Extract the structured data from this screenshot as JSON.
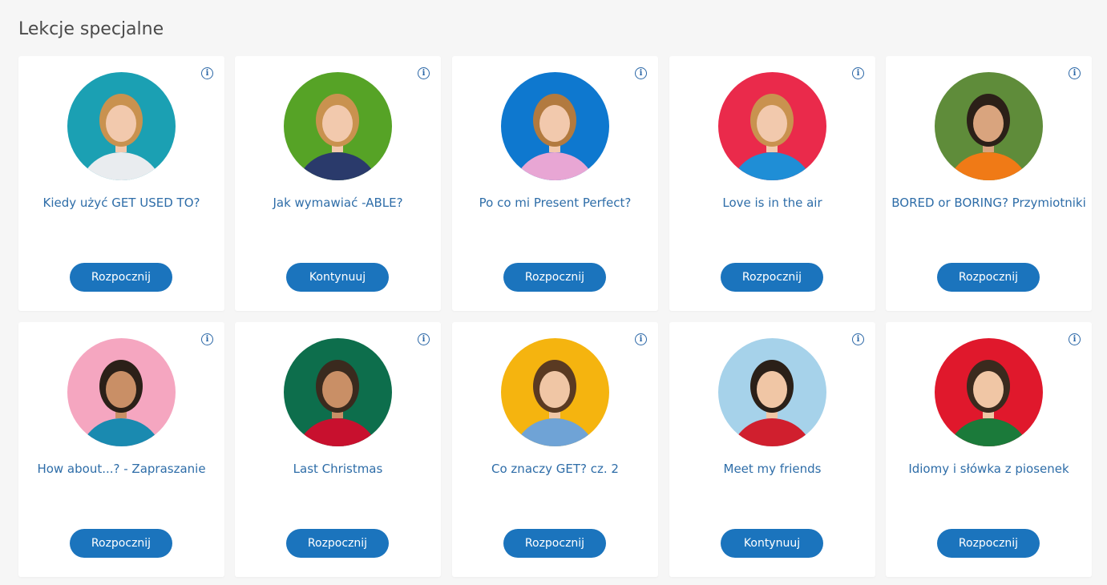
{
  "page": {
    "title": "Lekcje specjalne"
  },
  "info_icon_glyph": "i",
  "cards": [
    {
      "title": "Kiedy użyć GET USED TO?",
      "button": "Rozpocznij",
      "bg": "#1ba0b3",
      "shirt": "#e9ecef",
      "hair": "#c9924f",
      "skin": "#f2c9ad"
    },
    {
      "title": "Jak wymawiać -ABLE?",
      "button": "Kontynuuj",
      "bg": "#56a326",
      "shirt": "#2a3a6b",
      "hair": "#c9924f",
      "skin": "#f2c9ad"
    },
    {
      "title": "Po co mi Present Perfect?",
      "button": "Rozpocznij",
      "bg": "#0e78cf",
      "shirt": "#e8a6d4",
      "hair": "#b27a3f",
      "skin": "#f2c9ad"
    },
    {
      "title": "Love is in the air",
      "button": "Rozpocznij",
      "bg": "#ea2a4b",
      "shirt": "#1f8ed6",
      "hair": "#c9924f",
      "skin": "#f2c9ad"
    },
    {
      "title": "BORED or BORING? Przymiotniki",
      "button": "Rozpocznij",
      "bg": "#5f8c3a",
      "shirt": "#f07a16",
      "hair": "#2b2018",
      "skin": "#d9a47e"
    },
    {
      "title": "How about...? - Zapraszanie",
      "button": "Rozpocznij",
      "bg": "#f5a6c0",
      "shirt": "#1a8ab0",
      "hair": "#2b2018",
      "skin": "#c98f66"
    },
    {
      "title": "Last Christmas",
      "button": "Rozpocznij",
      "bg": "#0d6e4c",
      "shirt": "#c8102e",
      "hair": "#3a2a1e",
      "skin": "#c98f66"
    },
    {
      "title": "Co znaczy GET? cz. 2",
      "button": "Rozpocznij",
      "bg": "#f5b40f",
      "shirt": "#6fa3d6",
      "hair": "#5a3a22",
      "skin": "#f0c6a5"
    },
    {
      "title": "Meet my friends",
      "button": "Kontynuuj",
      "bg": "#a6d2ea",
      "shirt": "#d01f2e",
      "hair": "#2b2018",
      "skin": "#f0c6a5"
    },
    {
      "title": "Idiomy i słówka z piosenek",
      "button": "Rozpocznij",
      "bg": "#e0182c",
      "shirt": "#1b7a3a",
      "hair": "#3a2a1e",
      "skin": "#f0c6a5"
    }
  ]
}
